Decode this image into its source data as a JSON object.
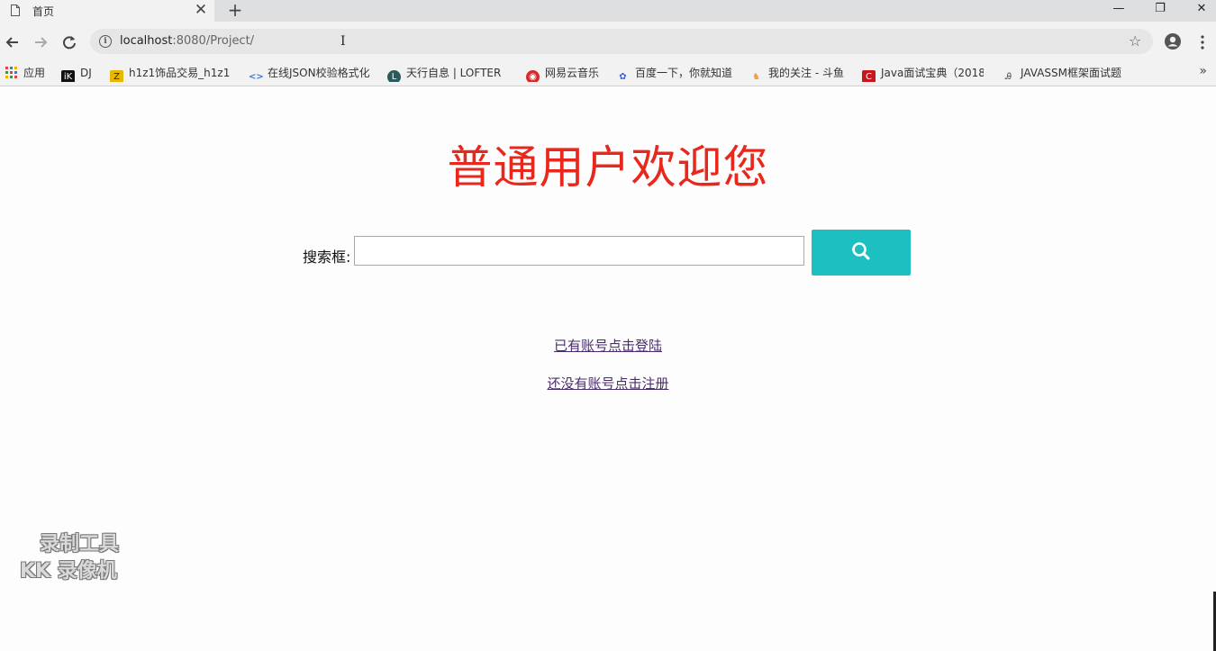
{
  "tab": {
    "title": "首页",
    "close": "✕",
    "new_tab": "+"
  },
  "window_controls": {
    "minimize": "—",
    "maximize": "❐",
    "close": "✕"
  },
  "omnibox": {
    "host": "localhost",
    "rest": ":8080/Project/",
    "info": "i"
  },
  "bookmarks": [
    {
      "label": "应用",
      "icon": "apps-grid-icon",
      "color": "#d44"
    },
    {
      "label": "DJ",
      "icon": "ik-icon",
      "color": "#111",
      "glyph": "iK"
    },
    {
      "label": "h1z1饰品交易_h1z1",
      "icon": "h1z1-icon",
      "color": "#333",
      "glyph": "Z"
    },
    {
      "label": "在线JSON校验格式化",
      "icon": "json-icon",
      "color": "#3a7bd5",
      "glyph": "<>"
    },
    {
      "label": "天行自息 | LOFTER",
      "icon": "lofter-icon",
      "color": "#2c5a5a",
      "glyph": "L"
    },
    {
      "label": "网易云音乐",
      "icon": "netease-music-icon",
      "color": "#d62a2a",
      "glyph": "◉"
    },
    {
      "label": "百度一下，你就知道",
      "icon": "baidu-paw-icon",
      "color": "#3a5fd9",
      "glyph": "✿"
    },
    {
      "label": "我的关注 - 斗鱼",
      "icon": "douyu-icon",
      "color": "#e8a03a",
      "glyph": "♞"
    },
    {
      "label": "Java面试宝典（2018",
      "icon": "csdn-icon",
      "color": "#c8161d",
      "glyph": "C"
    },
    {
      "label": "JAVASSM框架面试题",
      "icon": "ssm-icon",
      "color": "#666",
      "glyph": "Ꭿ"
    }
  ],
  "bookmarks_more": "»",
  "page": {
    "heading": "普通用户欢迎您",
    "search_label": "搜索框:",
    "search_value": "",
    "login_link": "已有账号点击登陆",
    "register_link": "还没有账号点击注册"
  },
  "watermark": {
    "line1": "录制工具",
    "line2": "KK 录像机"
  },
  "colors": {
    "heading": "#e8281c",
    "search_button": "#1ebfc1",
    "link": "#4b2c6e"
  }
}
